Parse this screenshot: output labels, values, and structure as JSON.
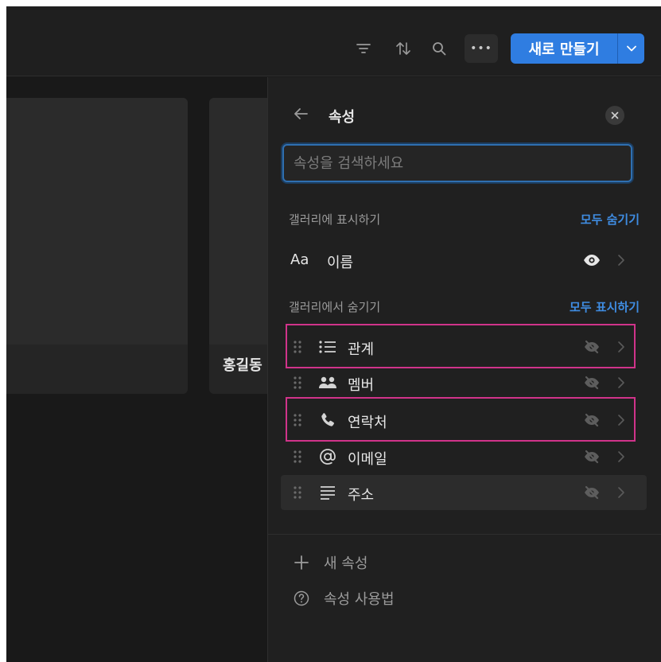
{
  "toolbar": {
    "icons": [
      "filter-icon",
      "sort-icon",
      "search-icon",
      "more-icon"
    ],
    "more_label": "•••",
    "new_button_label": "새로 만들기"
  },
  "gallery": {
    "cards": [
      {
        "title": ""
      },
      {
        "title": "홍길동"
      }
    ]
  },
  "panel": {
    "title": "속성",
    "search_placeholder": "속성을 검색하세요",
    "shown_section": {
      "label": "갤러리에 표시하기",
      "action": "모두 숨기기",
      "items": [
        {
          "type_label": "Aa",
          "type_icon": "text-type-icon",
          "name": "이름",
          "visible": true
        }
      ]
    },
    "hidden_section": {
      "label": "갤러리에서 숨기기",
      "action": "모두 표시하기",
      "items": [
        {
          "type_icon": "list-icon",
          "name": "관계",
          "visible": false,
          "highlighted": true
        },
        {
          "type_icon": "people-icon",
          "name": "멤버",
          "visible": false,
          "highlighted": false
        },
        {
          "type_icon": "phone-icon",
          "name": "연락처",
          "visible": false,
          "highlighted": true
        },
        {
          "type_icon": "at-icon",
          "name": "이메일",
          "visible": false,
          "highlighted": false
        },
        {
          "type_icon": "text-lines-icon",
          "name": "주소",
          "visible": false,
          "highlighted": false
        }
      ]
    },
    "footer": [
      {
        "icon": "plus-icon",
        "label": "새 속성"
      },
      {
        "icon": "help-icon",
        "label": "속성 사용법"
      }
    ]
  },
  "colors": {
    "accent": "#2f7de1",
    "link": "#3f8de3",
    "highlight_border": "#d0338a",
    "background": "#191919"
  }
}
